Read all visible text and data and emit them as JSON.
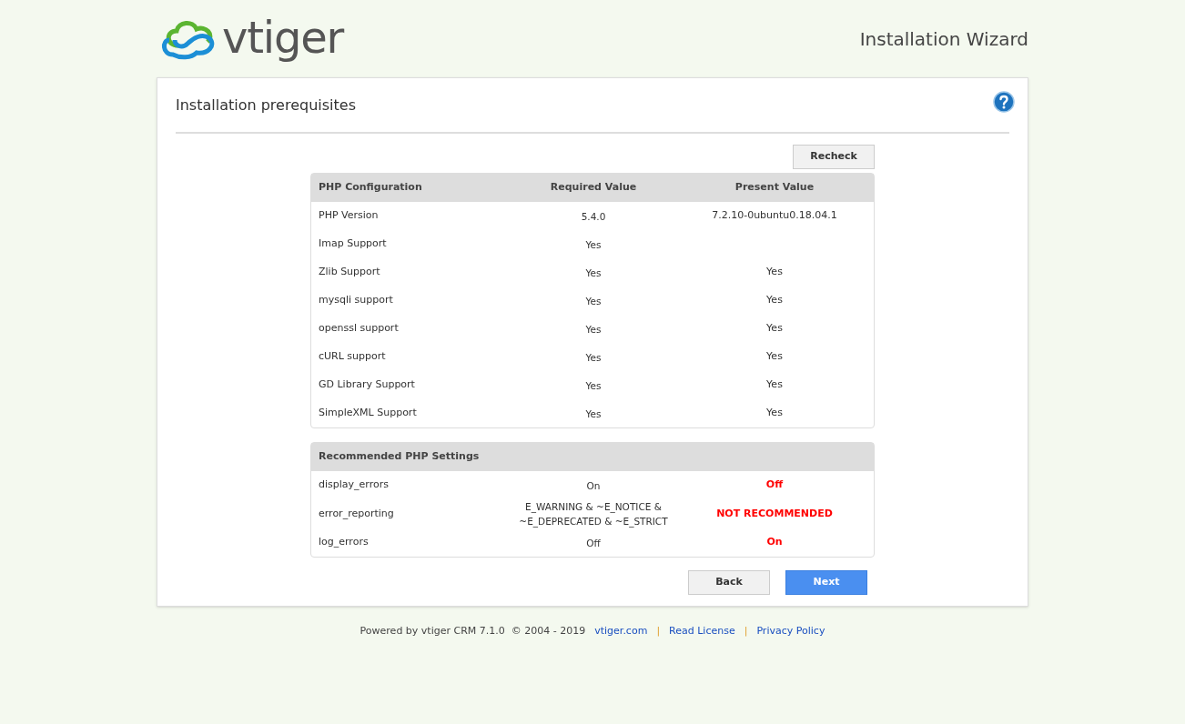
{
  "logo": {
    "text": "vtiger"
  },
  "header": {
    "title": "Installation Wizard"
  },
  "panel": {
    "title": "Installation prerequisites"
  },
  "recheck_button": "Recheck",
  "php_configuration": {
    "columns": [
      "PHP Configuration",
      "Required Value",
      "Present Value"
    ],
    "rows": [
      {
        "name": "PHP Version",
        "required": "5.4.0",
        "present": "7.2.10-0ubuntu0.18.04.1"
      },
      {
        "name": "Imap Support",
        "required": "Yes"
      },
      {
        "name": "Zlib Support",
        "required": "Yes",
        "present": "Yes"
      },
      {
        "name": "mysqli support",
        "required": "Yes",
        "present": "Yes"
      },
      {
        "name": "openssl support",
        "required": "Yes",
        "present": "Yes"
      },
      {
        "name": "cURL support",
        "required": "Yes",
        "present": "Yes"
      },
      {
        "name": "GD Library Support",
        "required": "Yes",
        "present": "Yes"
      },
      {
        "name": "SimpleXML Support",
        "required": "Yes",
        "present": "Yes"
      }
    ]
  },
  "recommended_settings": {
    "title": "Recommended PHP Settings",
    "rows": [
      {
        "name": "display_errors",
        "required": "On",
        "present": "Off",
        "warning": true
      },
      {
        "name": "error_reporting",
        "required": "E_WARNING & ~E_NOTICE & ~E_DEPRECATED & ~E_STRICT",
        "present": "NOT RECOMMENDED",
        "warning": true
      },
      {
        "name": "log_errors",
        "required": "Off",
        "present": "On",
        "warning": true
      }
    ]
  },
  "buttons": {
    "back": "Back",
    "next": "Next"
  },
  "footer": {
    "powered": "Powered by vtiger CRM 7.1.0  © 2004 - 2019",
    "links": [
      "vtiger.com",
      "Read License",
      "Privacy Policy"
    ],
    "separator": "|"
  }
}
